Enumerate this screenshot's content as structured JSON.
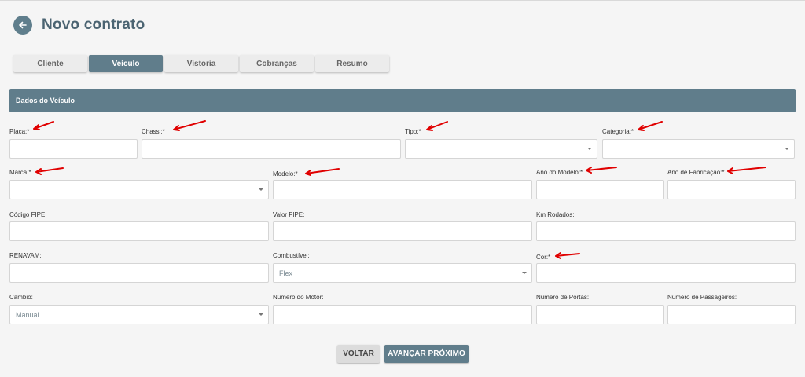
{
  "header": {
    "title": "Novo contrato"
  },
  "tabs": [
    {
      "label": "Cliente"
    },
    {
      "label": "Veículo"
    },
    {
      "label": "Vistoria"
    },
    {
      "label": "Cobranças"
    },
    {
      "label": "Resumo"
    }
  ],
  "active_tab": "Veículo",
  "section": {
    "title": "Dados do Veículo"
  },
  "fields": {
    "placa": {
      "label": "Placa:*",
      "value": ""
    },
    "chassi": {
      "label": "Chassi:*",
      "value": ""
    },
    "tipo": {
      "label": "Tipo:*",
      "value": ""
    },
    "categoria": {
      "label": "Categoria:*",
      "value": ""
    },
    "marca": {
      "label": "Marca:*",
      "value": ""
    },
    "modelo": {
      "label": "Modelo:*",
      "value": ""
    },
    "ano_modelo": {
      "label": "Ano do Modelo:*",
      "value": ""
    },
    "ano_fabricacao": {
      "label": "Ano de Fabricação:*",
      "value": ""
    },
    "codigo_fipe": {
      "label": "Código FIPE:",
      "value": ""
    },
    "valor_fipe": {
      "label": "Valor FIPE:",
      "value": ""
    },
    "km_rodados": {
      "label": "Km Rodados:",
      "value": ""
    },
    "renavam": {
      "label": "RENAVAM:",
      "value": ""
    },
    "combustivel": {
      "label": "Combustível:",
      "value": "Flex"
    },
    "cor": {
      "label": "Cor:*",
      "value": ""
    },
    "cambio": {
      "label": "Câmbio:",
      "value": "Manual"
    },
    "numero_motor": {
      "label": "Número do Motor:",
      "value": ""
    },
    "numero_portas": {
      "label": "Número de Portas:",
      "value": ""
    },
    "numero_passageiros": {
      "label": "Número de Passageiros:",
      "value": ""
    }
  },
  "buttons": {
    "back": "VOLTAR",
    "next": "AVANÇAR PRÓXIMO"
  },
  "colors": {
    "accent": "#607d8b",
    "annotation_arrow": "#e00000"
  }
}
